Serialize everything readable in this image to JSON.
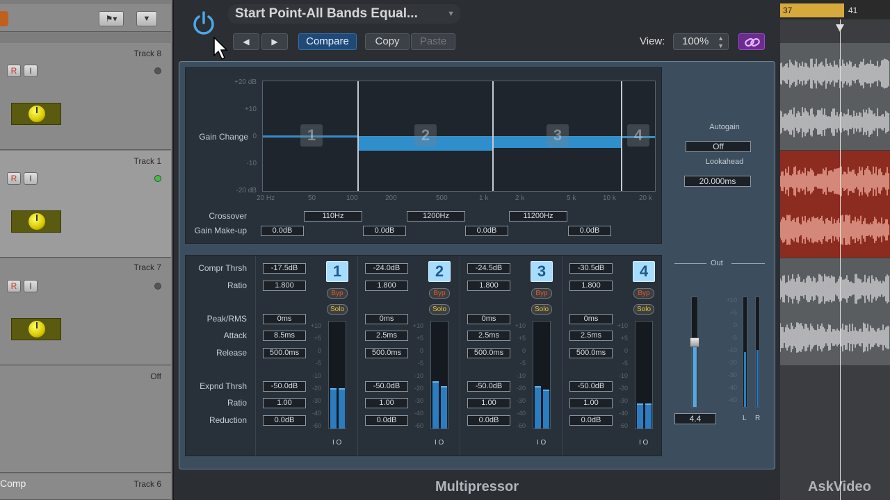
{
  "tracks": [
    {
      "name": "Track 8",
      "r": "R",
      "i": "I"
    },
    {
      "name": "Track 1",
      "r": "R",
      "i": "I"
    },
    {
      "name": "Track 7",
      "r": "R",
      "i": "I"
    }
  ],
  "off_label": "Off",
  "comp_label": "Comp",
  "track6_label": "Track 6",
  "header": {
    "preset": "Start Point-All Bands Equal...",
    "compare": "Compare",
    "copy": "Copy",
    "paste": "Paste",
    "view_label": "View:",
    "zoom": "100%",
    "prev_arrow": "◀",
    "next_arrow": "▶"
  },
  "graph": {
    "y_ticks": [
      "+20 dB",
      "+10",
      "0",
      "-10",
      "-20 dB"
    ],
    "y_label": "Gain Change",
    "x_ticks": [
      "20 Hz",
      "50",
      "100",
      "200",
      "500",
      "1 k",
      "2 k",
      "5 k",
      "10 k",
      "20 k"
    ],
    "band_labels": [
      "1",
      "2",
      "3",
      "4"
    ],
    "gain_change_db": [
      0,
      -5,
      -4,
      -0.5
    ],
    "crossover_label": "Crossover",
    "crossovers": [
      "110Hz",
      "1200Hz",
      "11200Hz"
    ],
    "makeup_label": "Gain Make-up",
    "makeups": [
      "0.0dB",
      "0.0dB",
      "0.0dB",
      "0.0dB"
    ]
  },
  "side": {
    "autogain_label": "Autogain",
    "autogain_value": "Off",
    "lookahead_label": "Lookahead",
    "lookahead_value": "20.000ms"
  },
  "rows": {
    "compr_thrsh": "Compr Thrsh",
    "ratio": "Ratio",
    "peak_rms": "Peak/RMS",
    "attack": "Attack",
    "release": "Release",
    "expnd_thrsh": "Expnd Thrsh",
    "ratio2": "Ratio",
    "reduction": "Reduction"
  },
  "bands": [
    {
      "num": "1",
      "compr": "-17.5dB",
      "ratio": "1.800",
      "peak": "0ms",
      "attack": "8.5ms",
      "release": "500.0ms",
      "expnd": "-50.0dB",
      "eratio": "1.00",
      "reduction": "0.0dB",
      "byp": "Byp",
      "solo": "Solo",
      "in_level": 0.38,
      "out_level": 0.38
    },
    {
      "num": "2",
      "compr": "-24.0dB",
      "ratio": "1.800",
      "peak": "0ms",
      "attack": "2.5ms",
      "release": "500.0ms",
      "expnd": "-50.0dB",
      "eratio": "1.00",
      "reduction": "0.0dB",
      "byp": "Byp",
      "solo": "Solo",
      "in_level": 0.45,
      "out_level": 0.4
    },
    {
      "num": "3",
      "compr": "-24.5dB",
      "ratio": "1.800",
      "peak": "0ms",
      "attack": "2.5ms",
      "release": "500.0ms",
      "expnd": "-50.0dB",
      "eratio": "1.00",
      "reduction": "0.0dB",
      "byp": "Byp",
      "solo": "Solo",
      "in_level": 0.4,
      "out_level": 0.37
    },
    {
      "num": "4",
      "compr": "-30.5dB",
      "ratio": "1.800",
      "peak": "0ms",
      "attack": "2.5ms",
      "release": "500.0ms",
      "expnd": "-50.0dB",
      "eratio": "1.00",
      "reduction": "0.0dB",
      "byp": "Byp",
      "solo": "Solo",
      "in_level": 0.24,
      "out_level": 0.24
    }
  ],
  "meter_scale": [
    "+10",
    "+5",
    "0",
    "-5",
    "-10",
    "-20",
    "-30",
    "-40",
    "-60"
  ],
  "io_label": "I  O",
  "out": {
    "label": "Out",
    "value": "4.4",
    "scale": [
      "+10",
      "+5",
      "0",
      "-5",
      "-10",
      "-20",
      "-30",
      "-40",
      "-60"
    ],
    "l": "L",
    "r": "R",
    "fader_level": 0.59,
    "l_level": 0.5,
    "r_level": 0.52
  },
  "plugin_name": "Multipressor",
  "ruler": {
    "bar1": "37",
    "bar2": "41"
  },
  "watermark": "AskVideo"
}
